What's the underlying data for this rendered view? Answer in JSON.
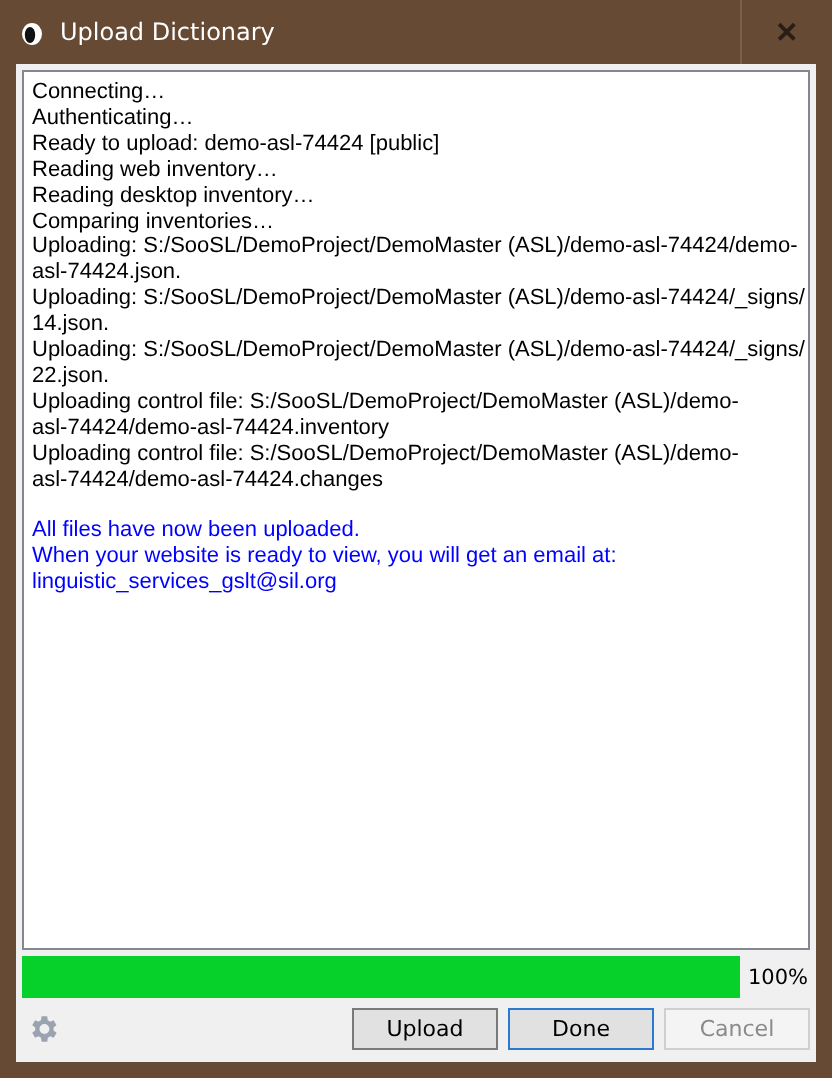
{
  "window": {
    "title": "Upload Dictionary",
    "close": "✕"
  },
  "log": {
    "lines": [
      "Connecting…",
      "Authenticating…",
      "Ready to upload: demo-asl-74424 [public]",
      "Reading web inventory…",
      "Reading desktop inventory…",
      "Comparing inventories…",
      "Uploading: S:/SooSL/DemoProject/DemoMaster (ASL)/demo-asl-74424/demo-",
      "asl-74424.json.",
      "Uploading: S:/SooSL/DemoProject/DemoMaster (ASL)/demo-asl-74424/_signs/",
      "14.json.",
      "Uploading: S:/SooSL/DemoProject/DemoMaster (ASL)/demo-asl-74424/_signs/",
      "22.json.",
      "Uploading control file: S:/SooSL/DemoProject/DemoMaster (ASL)/demo-",
      "asl-74424/demo-asl-74424.inventory",
      "Uploading control file: S:/SooSL/DemoProject/DemoMaster (ASL)/demo-",
      "asl-74424/demo-asl-74424.changes"
    ],
    "summary": [
      "All files have now been uploaded.",
      "When your website is ready to view, you will get an email at:",
      "linguistic_services_gslt@sil.org"
    ]
  },
  "progress": {
    "level": 1,
    "reading": "100%"
  },
  "buttons": [
    {
      "label": "Upload",
      "default": false,
      "disabled": false
    },
    {
      "label": "Done",
      "default": true,
      "disabled": false
    },
    {
      "label": "Cancel",
      "default": false,
      "disabled": true
    }
  ]
}
